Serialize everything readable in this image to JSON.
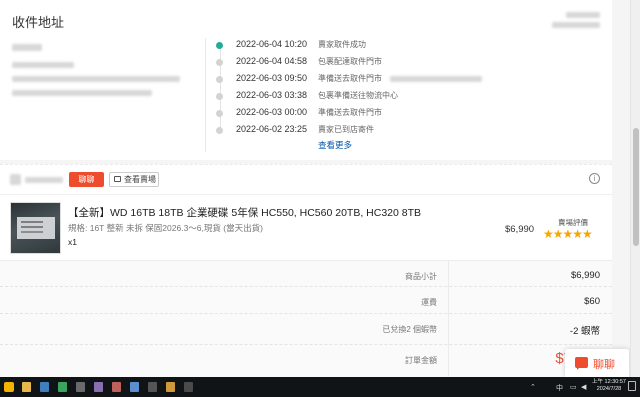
{
  "address": {
    "title": "收件地址"
  },
  "timeline": [
    {
      "time": "2022-06-04 10:20",
      "desc": "賣家取件成功",
      "active": true
    },
    {
      "time": "2022-06-04 04:58",
      "desc": "包裹配達取件門市",
      "active": false
    },
    {
      "time": "2022-06-03 09:50",
      "desc": "準備送去取件門市",
      "active": false
    },
    {
      "time": "2022-06-03 03:38",
      "desc": "包裹準備送往物流中心",
      "active": false
    },
    {
      "time": "2022-06-03 00:00",
      "desc": "準備送去取件門市",
      "active": false
    },
    {
      "time": "2022-06-02 23:25",
      "desc": "賣家已到店寄件",
      "active": false
    }
  ],
  "see_more": "查看更多",
  "shop": {
    "chat_label": "聊聊",
    "view_shop_label": "查看賣場",
    "info_icon": "info-icon"
  },
  "product": {
    "name": "【全新】WD 16TB 18TB 企業硬碟 5年保 HC550, HC560 20TB, HC320 8TB",
    "variation": "規格: 16T 整新 未拆 保固2026.3～6,現貨 (當天出貨)",
    "quantity": "x1",
    "price": "$6,990",
    "rating_label": "賣場評價",
    "stars": "★★★★★",
    "rating": 5
  },
  "summary": [
    {
      "label": "商品小計",
      "value": "$6,990"
    },
    {
      "label": "運費",
      "value": "$60"
    },
    {
      "label": "已兌換2 個蝦幣",
      "value": "-2 蝦幣"
    },
    {
      "label": "訂單金額",
      "value": "$7",
      "total": true
    }
  ],
  "chat_float": {
    "label": "聊聊"
  },
  "taskbar": {
    "tray_text": "中",
    "clock_time": "上午 12:30:57",
    "clock_date": "2024/7/28"
  },
  "colors": {
    "accent": "#ee4d2d",
    "active_dot": "#26aa99",
    "link": "#0055aa",
    "star": "#f6a700"
  }
}
